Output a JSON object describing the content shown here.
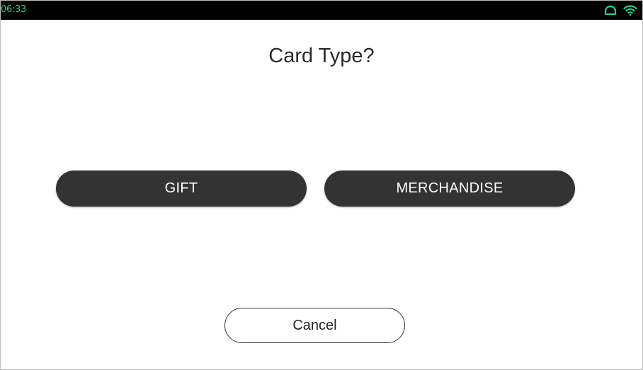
{
  "status_bar": {
    "time": "06:33",
    "accent_color": "#1fd18a",
    "icons": [
      "cloud-icon",
      "wifi-icon"
    ]
  },
  "prompt": {
    "title": "Card Type?"
  },
  "options": [
    {
      "label": "GIFT"
    },
    {
      "label": "MERCHANDISE"
    }
  ],
  "cancel_label": "Cancel"
}
